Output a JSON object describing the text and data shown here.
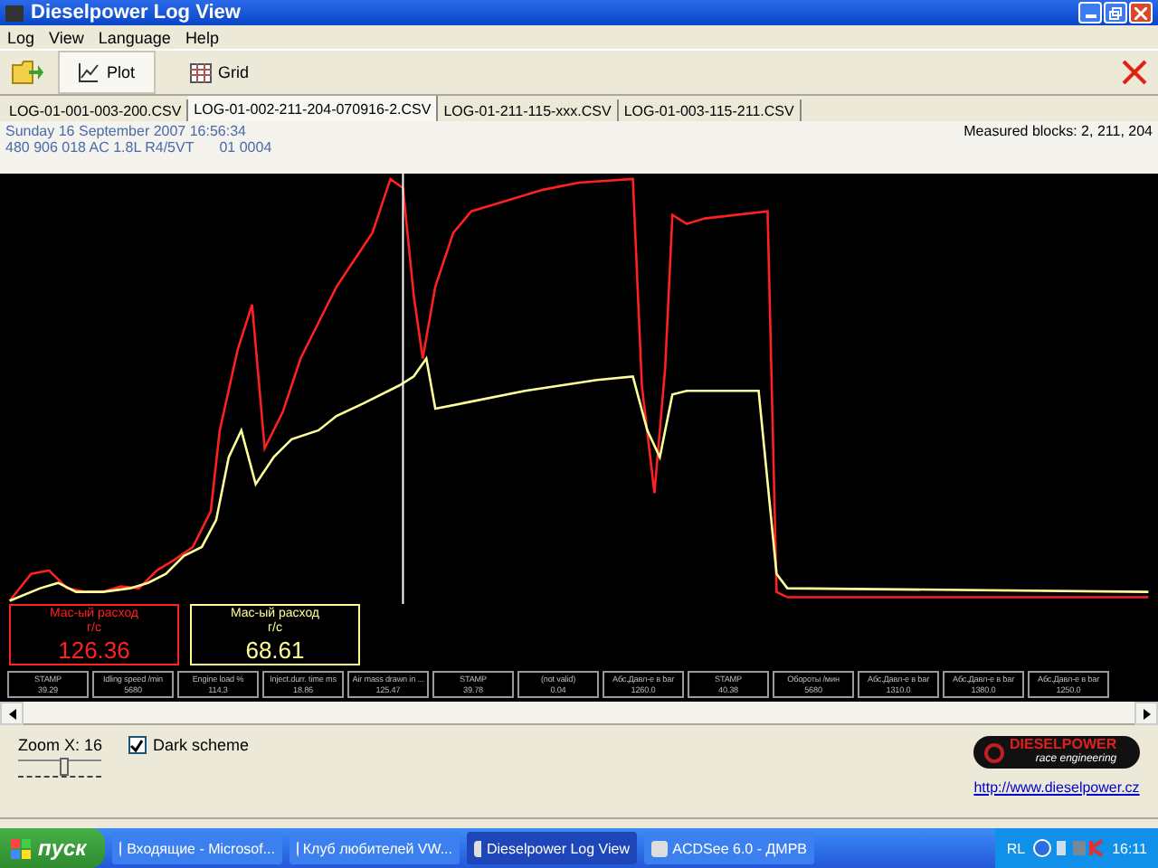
{
  "window": {
    "title": "Dieselpower Log View"
  },
  "menu": [
    "Log",
    "View",
    "Language",
    "Help"
  ],
  "toolbar": [
    {
      "label": "Plot",
      "kind": "plot",
      "selected": true
    },
    {
      "label": "Grid",
      "kind": "grid",
      "selected": false
    }
  ],
  "file_tabs": [
    {
      "label": "LOG-01-001-003-200.CSV",
      "selected": false
    },
    {
      "label": "LOG-01-002-211-204-070916-2.CSV",
      "selected": true
    },
    {
      "label": "LOG-01-211-115-xxx.CSV",
      "selected": false
    },
    {
      "label": "LOG-01-003-115-211.CSV",
      "selected": false
    }
  ],
  "info": {
    "date": "Sunday 16 September 2007 16:56:34",
    "ecu": "480 906 018 AC  1.8L R4/5VT",
    "code": "01 0004",
    "blocks": "Measured blocks: 2, 211, 204"
  },
  "legend": [
    {
      "label": "Мас-ый расход",
      "unit": "г/с",
      "value": "126.36",
      "color": "#ff2020"
    },
    {
      "label": "Мас-ый расход",
      "unit": "г/с",
      "value": "68.61",
      "color": "#ffff99"
    }
  ],
  "readouts": [
    {
      "label": "STAMP",
      "value": "39.29"
    },
    {
      "label": "Idling speed /min",
      "value": "5680"
    },
    {
      "label": "Engine load %",
      "value": "114.3"
    },
    {
      "label": "Inject.durr. time ms",
      "value": "18.86"
    },
    {
      "label": "Air mass drawn in ...",
      "value": "125.47"
    },
    {
      "label": "STAMP",
      "value": "39.78"
    },
    {
      "label": "(not valid)",
      "value": "0.04"
    },
    {
      "label": "Абс.Давл-е в bar",
      "value": "1260.0"
    },
    {
      "label": "STAMP",
      "value": "40.38"
    },
    {
      "label": "Обороты /мин",
      "value": "5680"
    },
    {
      "label": "Абс.Давл-е в bar",
      "value": "1310.0"
    },
    {
      "label": "Абс.Давл-е в bar",
      "value": "1380.0"
    },
    {
      "label": "Абс.Давл-е в bar",
      "value": "1250.0"
    }
  ],
  "zoom": {
    "label": "Zoom X: 16",
    "level": 0.55
  },
  "dark_scheme": {
    "label": "Dark scheme",
    "checked": true
  },
  "logo": {
    "name": "DIESELPOWER",
    "tagline": "race engineering"
  },
  "link": "http://www.dieselpower.cz",
  "taskbar": {
    "start": "пуск",
    "tasks": [
      {
        "label": "Входящие - Microsof...",
        "selected": false
      },
      {
        "label": "Клуб любителей VW...",
        "selected": false
      },
      {
        "label": "Dieselpower Log View",
        "selected": true
      },
      {
        "label": "ACDSee 6.0 - ДМРВ",
        "selected": false
      }
    ],
    "lang": "RL",
    "clock": "16:11"
  }
}
